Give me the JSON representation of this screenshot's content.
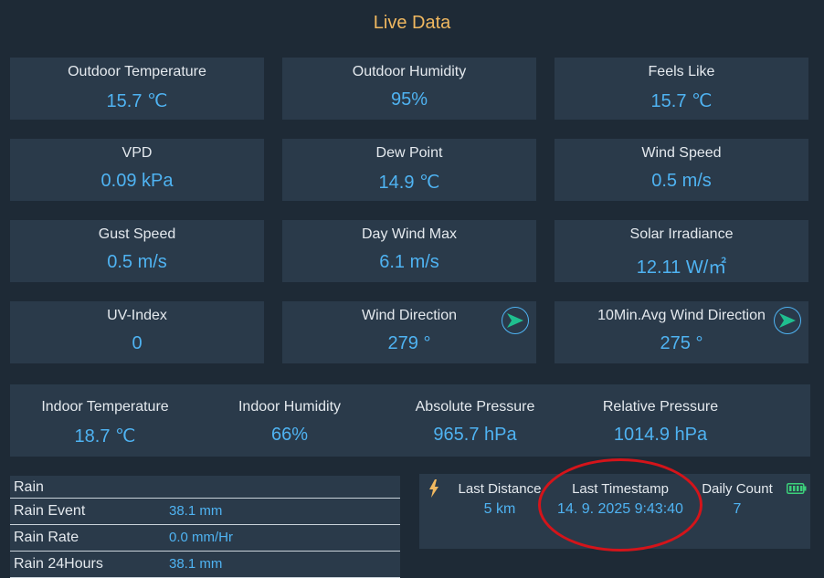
{
  "page": {
    "title": "Live Data"
  },
  "cards": [
    {
      "label": "Outdoor Temperature",
      "value": "15.7 ℃"
    },
    {
      "label": "Outdoor Humidity",
      "value": "95%"
    },
    {
      "label": "Feels Like",
      "value": "15.7 ℃"
    },
    {
      "label": "VPD",
      "value": "0.09 kPa"
    },
    {
      "label": "Dew Point",
      "value": "14.9 ℃"
    },
    {
      "label": "Wind Speed",
      "value": "0.5 m/s"
    },
    {
      "label": "Gust Speed",
      "value": "0.5 m/s"
    },
    {
      "label": "Day Wind Max",
      "value": "6.1 m/s"
    },
    {
      "label": "Solar Irradiance",
      "value": "12.11 W/㎡"
    },
    {
      "label": "UV-Index",
      "value": "0"
    },
    {
      "label": "Wind Direction",
      "value": "279 °",
      "icon": "wind-direction-arrow-icon"
    },
    {
      "label": "10Min.Avg Wind Direction",
      "value": "275 °",
      "icon": "wind-direction-arrow-icon"
    }
  ],
  "indoor": [
    {
      "label": "Indoor Temperature",
      "value": "18.7 ℃"
    },
    {
      "label": "Indoor Humidity",
      "value": "66%"
    },
    {
      "label": "Absolute Pressure",
      "value": "965.7 hPa"
    },
    {
      "label": "Relative Pressure",
      "value": "1014.9 hPa"
    }
  ],
  "rain": {
    "header": "Rain",
    "rows": [
      {
        "label": "Rain Event",
        "value": "38.1 mm"
      },
      {
        "label": "Rain Rate",
        "value": "0.0 mm/Hr"
      },
      {
        "label": "Rain 24Hours",
        "value": "38.1 mm"
      }
    ]
  },
  "lightning": {
    "icon": "lightning-bolt-icon",
    "battery_icon": "battery-full-icon",
    "last_distance": {
      "label": "Last Distance",
      "value": "5 km"
    },
    "last_timestamp": {
      "label": "Last Timestamp",
      "value": "14. 9. 2025 9:43:40"
    },
    "daily_count": {
      "label": "Daily Count",
      "value": "7"
    }
  },
  "colors": {
    "background": "#1e2a36",
    "card": "#2a3a4a",
    "title": "#f0b860",
    "value": "#4fb3f2",
    "icon_arrow": "#1fbf8f",
    "battery": "#3ccf7a",
    "annotation": "#d4141a"
  }
}
